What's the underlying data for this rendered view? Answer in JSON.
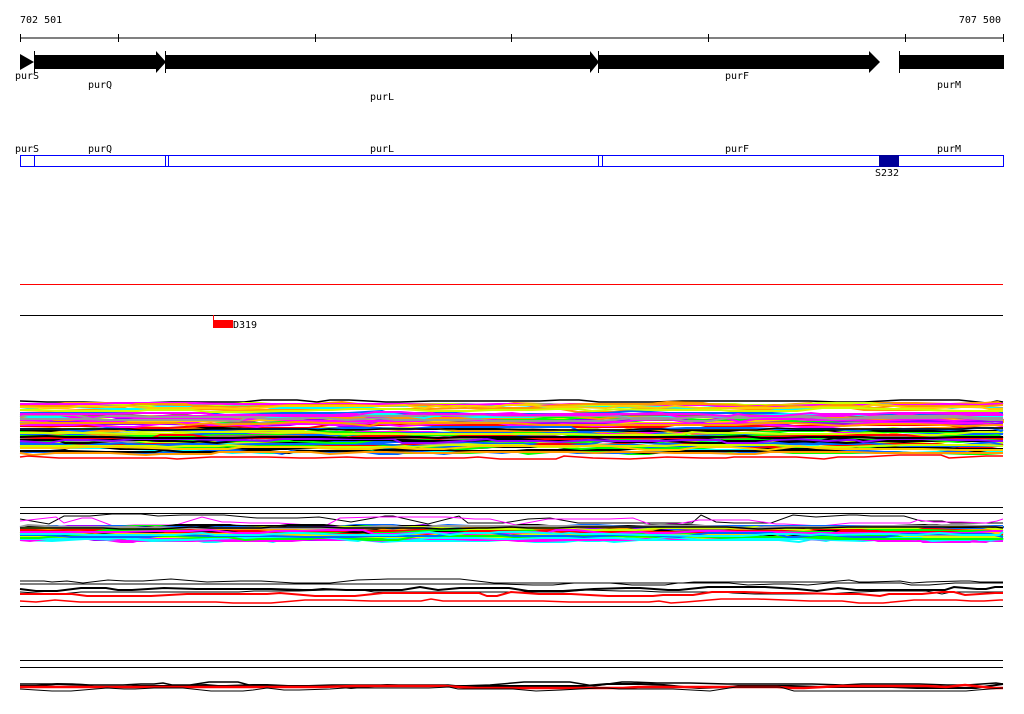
{
  "ruler": {
    "start_label": "702 501",
    "end_label": "707 500"
  },
  "genes": [
    {
      "name": "purS"
    },
    {
      "name": "purQ"
    },
    {
      "name": "purL"
    },
    {
      "name": "purF"
    },
    {
      "name": "purM"
    }
  ],
  "feature_track": {
    "labels": [
      "purS",
      "purQ",
      "purL",
      "purF",
      "purM"
    ],
    "site_label": "S232",
    "site_color": "#000099",
    "box_color": "#0000ff"
  },
  "mutation_track": {
    "label": "D319",
    "color": "#ff0000"
  },
  "colors": {
    "palette": [
      "#ff00ff",
      "#00ffff",
      "#00ff00",
      "#ff0000",
      "#0066ff",
      "#ff9900",
      "#999999",
      "#ccff00",
      "#000000",
      "#9900ff",
      "#996666",
      "#ffcc00"
    ]
  }
}
